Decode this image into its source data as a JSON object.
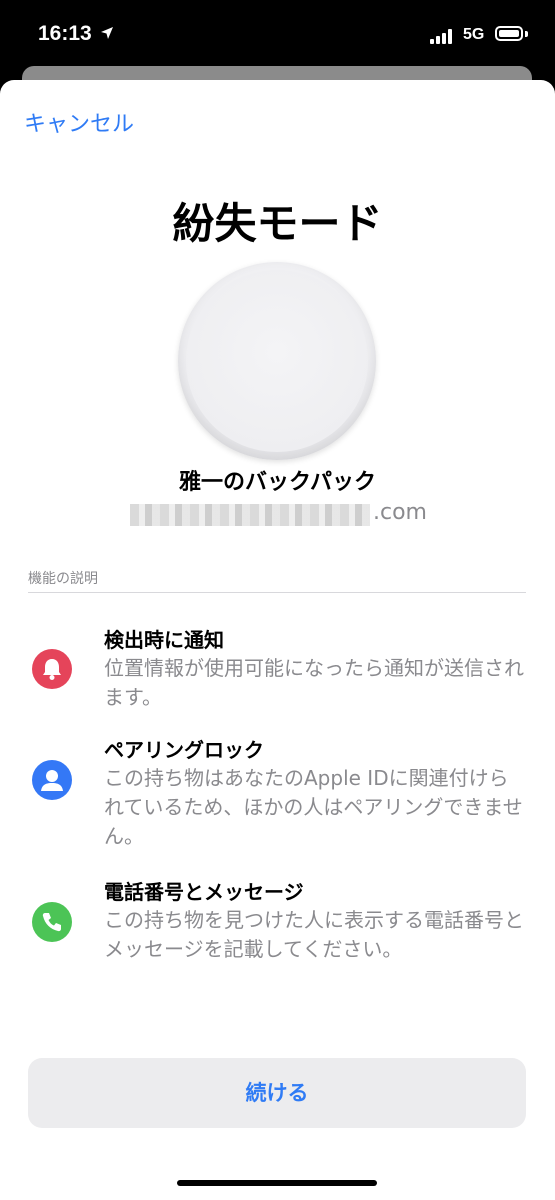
{
  "status_bar": {
    "time": "16:13",
    "network": "5G"
  },
  "sheet": {
    "cancel_label": "キャンセル",
    "title": "紛失モード",
    "item_name": "雅一のバックパック",
    "email_suffix": ".com",
    "section_header": "機能の説明",
    "features": [
      {
        "icon": "bell-icon",
        "color": "#e5445a",
        "title": "検出時に通知",
        "description": "位置情報が使用可能になったら通知が送信されます。"
      },
      {
        "icon": "person-icon",
        "color": "#3478f6",
        "title": "ペアリングロック",
        "description": "この持ち物はあなたのApple IDに関連付けられているため、ほかの人はペアリングできません。"
      },
      {
        "icon": "phone-icon",
        "color": "#4cc456",
        "title": "電話番号とメッセージ",
        "description": "この持ち物を見つけた人に表示する電話番号とメッセージを記載してください。"
      }
    ],
    "continue_label": "続ける"
  },
  "colors": {
    "accent": "#2f7bf5",
    "secondary_text": "#8a8a8e"
  }
}
